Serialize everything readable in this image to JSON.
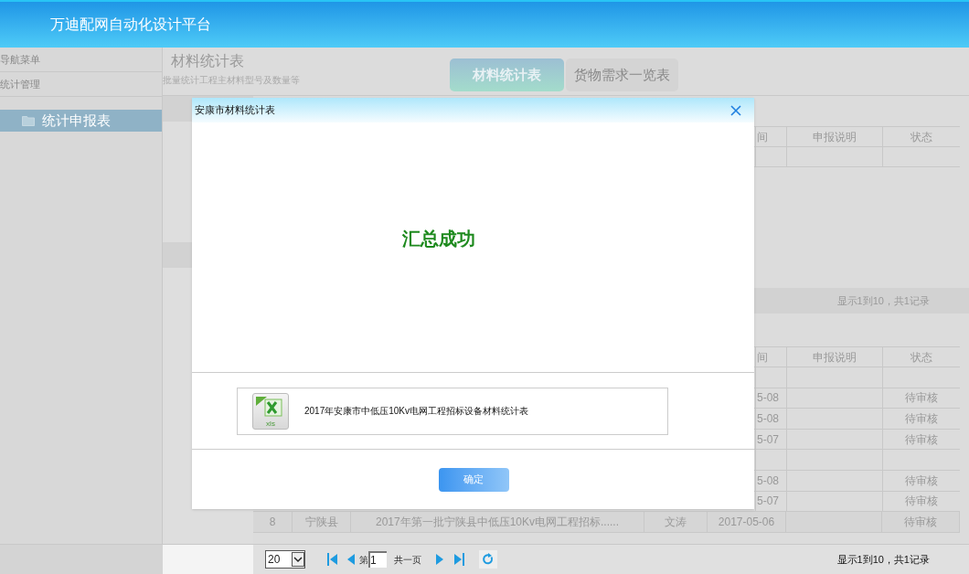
{
  "header": {
    "title": "万迪配网自动化设计平台"
  },
  "sidebar": {
    "sections": [
      {
        "label": "导航菜单"
      },
      {
        "label": "统计管理"
      }
    ],
    "items": [
      {
        "label": "统计申报表",
        "selected": true
      }
    ]
  },
  "page": {
    "title": "材料统计表",
    "subtitle": "批量统计工程主材料型号及数量等"
  },
  "tabs": [
    {
      "label": "材料统计表",
      "selected": true
    },
    {
      "label": "货物需求一览表",
      "selected": false
    }
  ],
  "table_1": {
    "columns": [
      "间",
      "申报说明",
      "状态"
    ],
    "pager_summary": "显示1到10，共1记录"
  },
  "table_2": {
    "columns": [
      "间",
      "申报说明",
      "状态"
    ],
    "rows": [
      {
        "kind": "empty"
      },
      {
        "kind": "partial",
        "date": "5-08",
        "status": "待审核"
      },
      {
        "kind": "partial",
        "date": "5-08",
        "status": "待审核"
      },
      {
        "kind": "partial",
        "date": "5-07",
        "status": "待审核"
      },
      {
        "kind": "empty"
      },
      {
        "kind": "partial",
        "date": "5-08",
        "status": "待审核"
      },
      {
        "kind": "partial",
        "date": "5-07",
        "status": "待审核"
      },
      {
        "kind": "full",
        "cells": [
          "8",
          "宁陕县",
          "2017年第一批宁陕县中低压10Kv电网工程招标......",
          "文涛",
          "2017-05-06",
          "",
          "待审核"
        ]
      }
    ]
  },
  "pager": {
    "page_size": "20",
    "page_prefix": "第",
    "page": "1",
    "total": "共一页",
    "summary": "显示1到10，共1记录"
  },
  "modal": {
    "title": "安康市材料统计表",
    "message": "汇总成功",
    "file": {
      "icon_label": "xls",
      "name": "2017年安康市中低压10Kv电网工程招标设备材料统计表"
    },
    "button": "确定"
  }
}
